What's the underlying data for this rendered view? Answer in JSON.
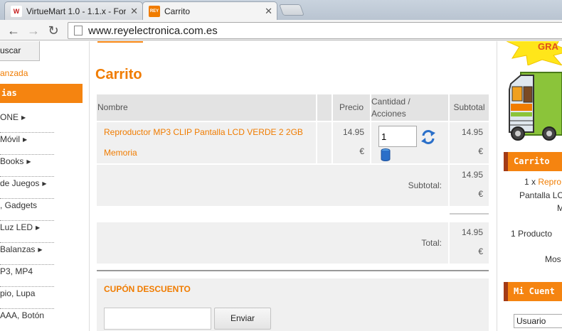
{
  "browser": {
    "tabs": [
      {
        "title": "VirtueMart 1.0 - 1.1.x - For",
        "favicon": "W"
      },
      {
        "title": "Carrito",
        "favicon": "REY"
      }
    ],
    "url": "www.reyelectronica.com.es"
  },
  "leftnav": {
    "search_button": "uscar",
    "advanced_link": "anzada",
    "categories_header": "ias",
    "categories": [
      {
        "label": "ONE",
        "arrow": "▶"
      },
      {
        "label": "Móvil",
        "arrow": "▶"
      },
      {
        "label": "Books",
        "arrow": "▶"
      },
      {
        "label": " de Juegos",
        "arrow": "▶"
      },
      {
        "label": ", Gadgets",
        "arrow": ""
      },
      {
        "label": " Luz LED",
        "arrow": "▶"
      },
      {
        "label": " Balanzas",
        "arrow": "▶"
      },
      {
        "label": "P3, MP4",
        "arrow": ""
      },
      {
        "label": "pio, Lupa",
        "arrow": ""
      },
      {
        "label": "AAA, Botón",
        "arrow": ""
      }
    ]
  },
  "cart": {
    "title": "Carrito",
    "headers": {
      "name": "Nombre",
      "price": "Precio",
      "qty_line1": "Cantidad /",
      "qty_line2": "Acciones",
      "subtotal": "Subtotal"
    },
    "item": {
      "name_line1": "Reproductor MP3 CLIP Pantalla LCD VERDE 2 2GB",
      "name_line2": "Memoria",
      "price": "14.95",
      "price_currency": "€",
      "qty": "1",
      "subtotal": "14.95",
      "subtotal_currency": "€"
    },
    "subtotal_label": "Subtotal:",
    "subtotal_value": "14.95",
    "subtotal_currency": "€",
    "total_label": "Total:",
    "total_value": "14.95",
    "total_currency": "€"
  },
  "coupon": {
    "title": "CUPÓN DESCUENTO",
    "input_value": "",
    "button": "Enviar"
  },
  "rightcol": {
    "star_text": "GRA",
    "cart_box_title": "Carrito",
    "mini_line1_qty": "1 x ",
    "mini_line1_link": "Repro",
    "mini_line2": "Pantalla LC",
    "mini_line3": "M",
    "product_count": "1 Producto",
    "show_link": "Mos",
    "account_box_title": "Mi Cuent",
    "user_select": "Usuario"
  },
  "colors": {
    "accent": "#f58410",
    "link": "#f07c00",
    "box_border": "#a33b16"
  }
}
